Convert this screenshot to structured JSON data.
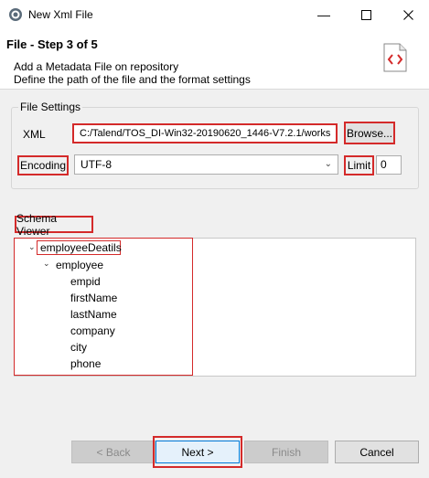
{
  "window": {
    "title": "New Xml File",
    "controls": [
      "minimize-icon",
      "maximize-icon",
      "close-icon"
    ]
  },
  "header": {
    "step_title": "File - Step 3 of 5",
    "description_line1": "Add a Metadata File on repository",
    "description_line2": "Define the path of the file and the format settings",
    "icon": "xml-file-icon"
  },
  "file_settings": {
    "group_label": "File Settings",
    "xml_label": "XML",
    "xml_path": "C:/Talend/TOS_DI-Win32-20190620_1446-V7.2.1/works",
    "browse_label": "Browse...",
    "encoding_label": "Encoding",
    "encoding_value": "UTF-8",
    "limit_label": "Limit",
    "limit_value": "0"
  },
  "schema_viewer": {
    "label": "Schema Viewer",
    "root": "employeeDeatils",
    "child": "employee",
    "fields": [
      "empid",
      "firstName",
      "lastName",
      "company",
      "city",
      "phone"
    ]
  },
  "buttons": {
    "back": "< Back",
    "next": "Next >",
    "finish": "Finish",
    "cancel": "Cancel"
  },
  "colors": {
    "highlight_red": "#d42a2a",
    "background": "#f0f0f0"
  }
}
